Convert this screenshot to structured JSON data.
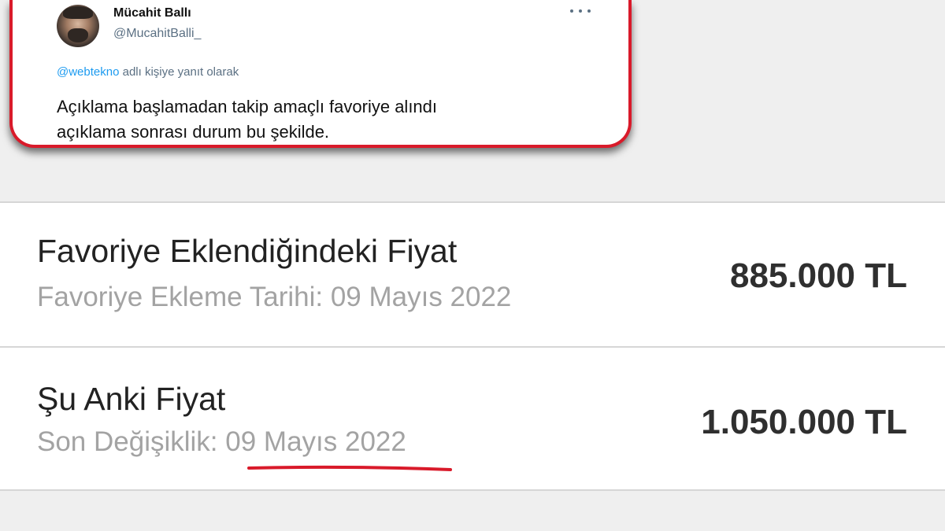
{
  "tweet": {
    "author_name": "Mücahit Ballı",
    "author_handle": "@MucahitBalli_",
    "reply_mention": "@webtekno",
    "reply_suffix": " adlı kişiye yanıt olarak",
    "text_line_1": "Açıklama başlamadan takip amaçlı favoriye alındı",
    "text_line_2": "açıklama sonrası durum bu şekilde.",
    "icons": {
      "more": "more-horizontal-icon",
      "avatar": "avatar"
    }
  },
  "price_rows": [
    {
      "title": "Favoriye Eklendiğindeki Fiyat",
      "subtitle": "Favoriye Ekleme Tarihi: 09 Mayıs 2022",
      "price": "885.000 TL"
    },
    {
      "title": "Şu Anki Fiyat",
      "subtitle_prefix": "Son Değişiklik: ",
      "subtitle_date": "09 Mayıs 2022",
      "price": "1.050.000 TL"
    }
  ],
  "colors": {
    "highlight_red": "#d91a2a",
    "mention_blue": "#1d9bf0",
    "background": "#efefef"
  }
}
